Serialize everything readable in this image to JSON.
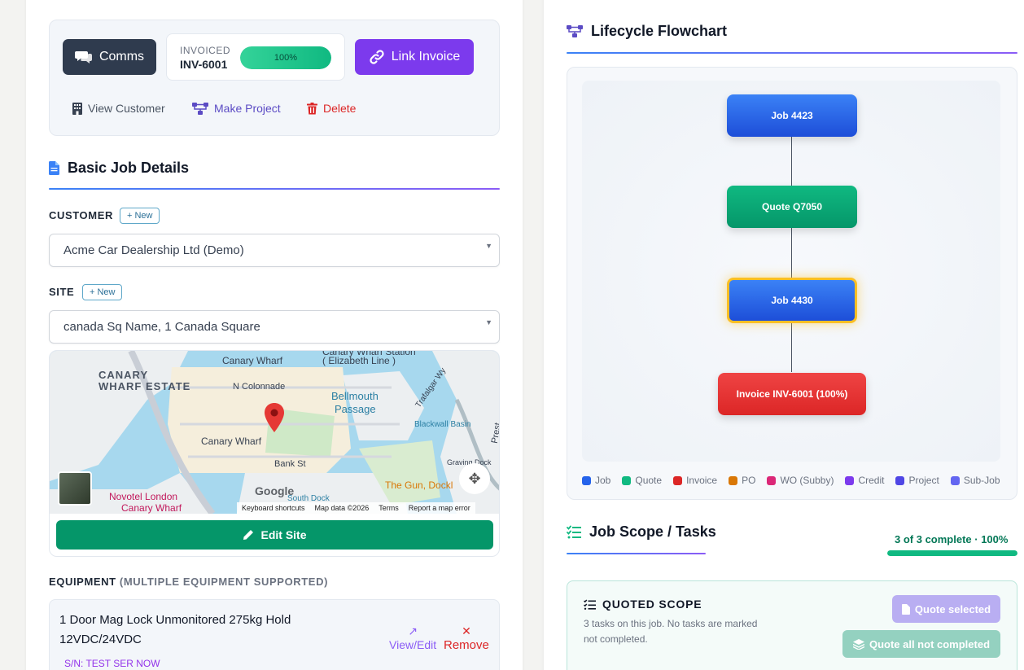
{
  "actions": {
    "comms_label": "Comms",
    "invoice_status": "INVOICED",
    "invoice_number": "INV-6001",
    "invoice_progress": 100,
    "invoice_progress_label": "100%",
    "link_invoice_label": "Link Invoice",
    "view_customer_label": "View Customer",
    "make_project_label": "Make Project",
    "delete_label": "Delete"
  },
  "basic_details": {
    "title": "Basic Job Details",
    "customer_label": "CUSTOMER",
    "customer_new": "New",
    "customer_value": "Acme Car Dealership Ltd (Demo)",
    "site_label": "SITE",
    "site_new": "New",
    "site_value": "canada Sq Name, 1 Canada Square",
    "edit_site_label": "Edit Site"
  },
  "map": {
    "labels": {
      "canary_wharf_estate_1": "CANARY",
      "canary_wharf_estate_2": "WHARF ESTATE",
      "canary_wharf_top": "Canary Wharf",
      "station_1": "Canary Wharf Station",
      "station_2": "( Elizabeth Line )",
      "n_colonnade": "N Colonnade",
      "bellmouth_1": "Bellmouth",
      "bellmouth_2": "Passage",
      "trafalgar": "Trafalgar Wy",
      "blackwall": "Blackwall Basin",
      "canary_wharf_mid": "Canary Wharf",
      "bank_st": "Bank St",
      "novotel_1": "Novotel London",
      "novotel_2": "Canary Wharf",
      "gun": "The Gun, Dockl",
      "graving": "Graving Dock",
      "south_dock": "South Dock",
      "prest": "Prest"
    },
    "google": "Google",
    "footer": [
      "Keyboard shortcuts",
      "Map data ©2026",
      "Terms",
      "Report a map error"
    ]
  },
  "equipment": {
    "label": "EQUIPMENT",
    "label_note": "(MULTIPLE EQUIPMENT SUPPORTED)",
    "item_name_1": "1 Door Mag Lock Unmonitored 275kg Hold",
    "item_name_2": "12VDC/24VDC",
    "serial": "S/N: TEST SER NOW",
    "view_edit_label": "View/Edit",
    "remove_label": "Remove"
  },
  "flowchart": {
    "title": "Lifecycle Flowchart",
    "nodes": [
      {
        "label": "Job 4423",
        "type": "job"
      },
      {
        "label": "Quote Q7050",
        "type": "quote"
      },
      {
        "label": "Job 4430",
        "type": "job",
        "current": true
      },
      {
        "label": "Invoice INV-6001 (100%)",
        "type": "invoice"
      }
    ],
    "legend": [
      {
        "label": "Job",
        "color": "#2563eb"
      },
      {
        "label": "Quote",
        "color": "#10b981"
      },
      {
        "label": "Invoice",
        "color": "#dc2626"
      },
      {
        "label": "PO",
        "color": "#d97706"
      },
      {
        "label": "WO (Subby)",
        "color": "#db2777"
      },
      {
        "label": "Credit",
        "color": "#7c3aed"
      },
      {
        "label": "Project",
        "color": "#4f46e5"
      },
      {
        "label": "Sub-Job",
        "color": "#6366f1"
      }
    ]
  },
  "scope": {
    "title": "Job Scope / Tasks",
    "complete_text": "3 of 3 complete · 100%",
    "complete_progress": 100,
    "quoted_title": "QUOTED SCOPE",
    "quoted_desc_1": "3 tasks on this job. No tasks are marked",
    "quoted_desc_2": "not completed.",
    "quote_selected_label": "Quote selected",
    "quote_all_label": "Quote all not completed"
  },
  "colors": {
    "job": "#2563eb",
    "quote": "#10b981",
    "invoice": "#dc2626",
    "accent_purple": "#7c3aed",
    "success": "#059669"
  }
}
